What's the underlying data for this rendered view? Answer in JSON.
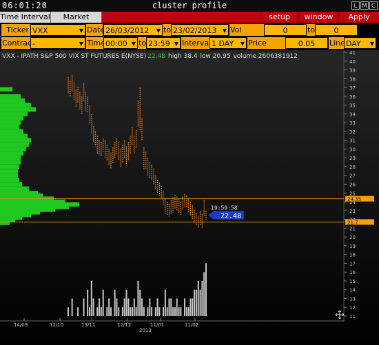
{
  "window": {
    "clock": "06:01:20",
    "title": "cluster profile",
    "buttons": [
      "L",
      "M",
      "C"
    ]
  },
  "tabs": [
    "Time Interval",
    "Market Watch"
  ],
  "actions": [
    "setup",
    "window",
    "Apply"
  ],
  "controls": {
    "ticker_label": "Ticker",
    "ticker": "VXX",
    "date_label": "Date",
    "date_from": "26/03/2012",
    "to1": "to",
    "date_to": "23/02/2013",
    "vol_range_label": "Vol range",
    "vol_from": "0",
    "to2": "to",
    "vol_to": "0",
    "contract_label": "Contract",
    "contract": "-",
    "time_label": "Time",
    "time_from": "00:00",
    "to3": "to",
    "time_to": "23:59",
    "interval_label": "Interval",
    "interval": "1 DAY",
    "price_scale_label": "Price Scale",
    "price_scale": "0.05",
    "line_label": "Line",
    "line": "DAY"
  },
  "info": {
    "instrument": "VXX - IPATH S&P 500 VIX ST FUTURES E(NYSE)",
    "last": "22.48",
    "high_label": "high",
    "high": "38.4",
    "low_label": "low",
    "low": "20.95",
    "volume_label": "volume",
    "volume": "2606381912"
  },
  "chart_data": {
    "type": "bar",
    "price_axis_labels": [
      "41",
      "40",
      "39",
      "38",
      "37",
      "36",
      "35",
      "34",
      "33",
      "32",
      "31",
      "30",
      "29",
      "28",
      "27",
      "26",
      "25",
      "24",
      "23",
      "22",
      "21",
      "20",
      "19",
      "18",
      "17",
      "16",
      "15",
      "14",
      "13",
      "12",
      "11"
    ],
    "ylim": [
      11,
      41
    ],
    "x_labels": [
      "14/09",
      "12/10",
      "13/11",
      "12/12",
      "11/01",
      "11/02"
    ],
    "year_label": "2013",
    "reference_lines": [
      {
        "label": "24.35",
        "value": 24.35
      },
      {
        "label": "21.7",
        "value": 21.7
      }
    ],
    "last_time": "19:59:58",
    "last_price": "22.48",
    "colors": {
      "bars": "#e0761a",
      "profile": "#1ec81e",
      "volume": "#c8c8c8",
      "ref_line": "#c88c1e",
      "ref_tag": "#f5a300",
      "last_tag": "#1a3ccc"
    },
    "series": [
      {
        "values": [
          {
            "h": 38.2,
            "l": 36.3
          },
          {
            "h": 37.8,
            "l": 36.0
          },
          {
            "h": 38.4,
            "l": 36.5
          },
          {
            "h": 37.6,
            "l": 35.6
          },
          {
            "h": 36.8,
            "l": 34.8
          },
          {
            "h": 37.1,
            "l": 35.3
          },
          {
            "h": 36.5,
            "l": 34.5
          },
          {
            "h": 36.0,
            "l": 34.0
          },
          {
            "h": 37.5,
            "l": 35.4
          },
          {
            "h": 36.5,
            "l": 34.3
          },
          {
            "h": 36.0,
            "l": 34.2
          },
          {
            "h": 35.0,
            "l": 32.8
          },
          {
            "h": 34.0,
            "l": 31.8
          },
          {
            "h": 32.6,
            "l": 30.8
          },
          {
            "h": 32.0,
            "l": 30.3
          },
          {
            "h": 31.5,
            "l": 29.5
          },
          {
            "h": 31.0,
            "l": 29.3
          },
          {
            "h": 30.8,
            "l": 29.2
          },
          {
            "h": 31.2,
            "l": 29.7
          },
          {
            "h": 31.0,
            "l": 29.0
          },
          {
            "h": 30.5,
            "l": 28.6
          },
          {
            "h": 30.0,
            "l": 28.2
          },
          {
            "h": 29.6,
            "l": 27.8
          },
          {
            "h": 30.2,
            "l": 28.4
          },
          {
            "h": 30.8,
            "l": 29.0
          },
          {
            "h": 31.2,
            "l": 29.3
          },
          {
            "h": 30.8,
            "l": 28.7
          },
          {
            "h": 30.0,
            "l": 28.0
          },
          {
            "h": 30.5,
            "l": 28.4
          },
          {
            "h": 31.0,
            "l": 29.0
          },
          {
            "h": 30.3,
            "l": 28.3
          },
          {
            "h": 30.8,
            "l": 28.7
          },
          {
            "h": 31.5,
            "l": 29.4
          },
          {
            "h": 32.5,
            "l": 30.5
          },
          {
            "h": 31.5,
            "l": 29.5
          },
          {
            "h": 32.2,
            "l": 30.1
          },
          {
            "h": 35.5,
            "l": 32.5
          },
          {
            "h": 37.0,
            "l": 32.0
          },
          {
            "h": 33.5,
            "l": 31.0
          },
          {
            "h": 30.2,
            "l": 27.6
          },
          {
            "h": 29.7,
            "l": 27.7
          },
          {
            "h": 29.0,
            "l": 27.0
          },
          {
            "h": 28.5,
            "l": 26.7
          },
          {
            "h": 28.2,
            "l": 26.5
          },
          {
            "h": 27.8,
            "l": 26.0
          },
          {
            "h": 27.0,
            "l": 25.4
          },
          {
            "h": 26.5,
            "l": 25.0
          },
          {
            "h": 26.2,
            "l": 24.7
          },
          {
            "h": 25.8,
            "l": 24.3
          },
          {
            "h": 25.2,
            "l": 23.6
          },
          {
            "h": 24.4,
            "l": 22.6
          },
          {
            "h": 24.0,
            "l": 22.5
          },
          {
            "h": 23.8,
            "l": 22.3
          },
          {
            "h": 24.2,
            "l": 22.6
          },
          {
            "h": 24.5,
            "l": 22.8
          },
          {
            "h": 24.8,
            "l": 23.2
          },
          {
            "h": 24.6,
            "l": 23.0
          },
          {
            "h": 24.3,
            "l": 22.7
          },
          {
            "h": 24.0,
            "l": 22.5
          },
          {
            "h": 24.6,
            "l": 23.1
          },
          {
            "h": 24.9,
            "l": 23.4
          },
          {
            "h": 24.7,
            "l": 23.3
          },
          {
            "h": 24.4,
            "l": 22.8
          },
          {
            "h": 24.0,
            "l": 22.4
          },
          {
            "h": 23.6,
            "l": 22.0
          },
          {
            "h": 23.1,
            "l": 21.6
          },
          {
            "h": 22.7,
            "l": 21.3
          },
          {
            "h": 22.4,
            "l": 21.0
          },
          {
            "h": 22.9,
            "l": 21.3
          },
          {
            "h": 22.6,
            "l": 20.95
          },
          {
            "h": 24.2,
            "l": 22.4
          },
          {
            "h": 23.0,
            "l": 22.0
          }
        ]
      }
    ],
    "volume": [
      12,
      11,
      13,
      10,
      11,
      12,
      9,
      10,
      13,
      11,
      14,
      12,
      15,
      13,
      11,
      12,
      13,
      12,
      14,
      11,
      12,
      13,
      12,
      11,
      14,
      13,
      12,
      11,
      12,
      13,
      14,
      13,
      12,
      12,
      13,
      12,
      15,
      14,
      13,
      12,
      11,
      12,
      13,
      12,
      11,
      12,
      13,
      12,
      11,
      12,
      14,
      12,
      13,
      13,
      12,
      12,
      13,
      12,
      12,
      11,
      13,
      12,
      12,
      13,
      13,
      14,
      14,
      15,
      14,
      15,
      16,
      17
    ],
    "profile": [
      {
        "price": 36.8,
        "v": 18
      },
      {
        "price": 36.0,
        "v": 30
      },
      {
        "price": 35.5,
        "v": 36
      },
      {
        "price": 35.0,
        "v": 45
      },
      {
        "price": 34.5,
        "v": 52
      },
      {
        "price": 34.0,
        "v": 40
      },
      {
        "price": 33.5,
        "v": 34
      },
      {
        "price": 33.0,
        "v": 30
      },
      {
        "price": 32.5,
        "v": 28
      },
      {
        "price": 32.0,
        "v": 34
      },
      {
        "price": 31.5,
        "v": 40
      },
      {
        "price": 31.0,
        "v": 45
      },
      {
        "price": 30.5,
        "v": 42
      },
      {
        "price": 30.0,
        "v": 38
      },
      {
        "price": 29.5,
        "v": 34
      },
      {
        "price": 29.0,
        "v": 30
      },
      {
        "price": 28.5,
        "v": 30
      },
      {
        "price": 28.0,
        "v": 28
      },
      {
        "price": 27.5,
        "v": 26
      },
      {
        "price": 27.0,
        "v": 26
      },
      {
        "price": 26.5,
        "v": 28
      },
      {
        "price": 26.0,
        "v": 32
      },
      {
        "price": 25.5,
        "v": 42
      },
      {
        "price": 25.0,
        "v": 55
      },
      {
        "price": 24.7,
        "v": 62
      },
      {
        "price": 24.35,
        "v": 78
      },
      {
        "price": 24.0,
        "v": 95
      },
      {
        "price": 23.7,
        "v": 115
      },
      {
        "price": 23.4,
        "v": 100
      },
      {
        "price": 23.1,
        "v": 80
      },
      {
        "price": 22.8,
        "v": 58
      },
      {
        "price": 22.5,
        "v": 45
      },
      {
        "price": 22.2,
        "v": 32
      },
      {
        "price": 21.9,
        "v": 22
      },
      {
        "price": 21.6,
        "v": 14
      }
    ]
  }
}
